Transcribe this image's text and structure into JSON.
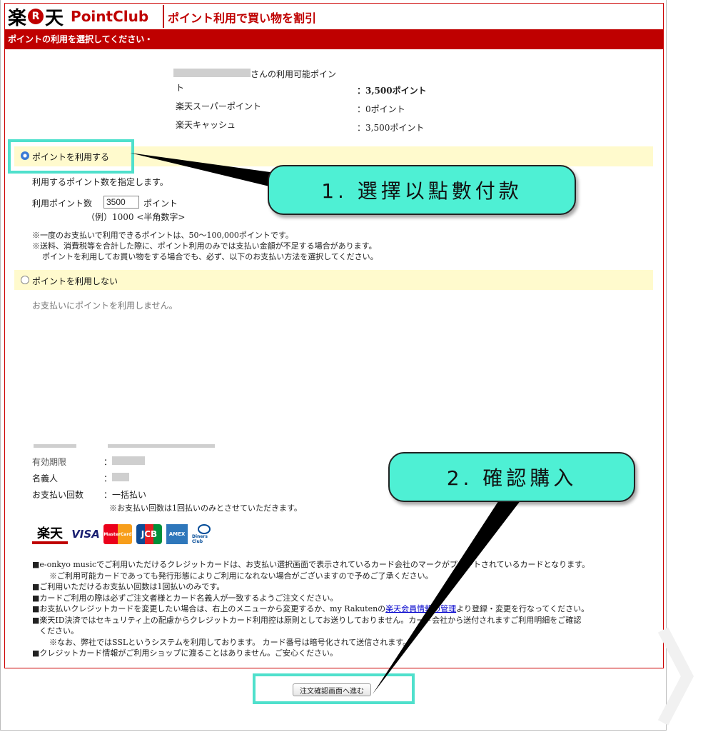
{
  "header": {
    "logo_kanji_1": "楽",
    "logo_circle": "R",
    "logo_kanji_2": "天",
    "logo_brand": "PointClub",
    "title": "ポイント利用で買い物を割引"
  },
  "section_bar": "ポイントの利用を選択してください・",
  "points": {
    "available_suffix": "さんの利用可能ポイン",
    "available_suffix_wrap": "ト",
    "available_value": "：3,500ポイント",
    "super_label": "楽天スーパーポイント",
    "super_value": "：0ポイント",
    "cash_label": "楽天キャッシュ",
    "cash_value": "：3,500ポイント"
  },
  "use_option": {
    "label": "ポイントを利用する",
    "instruction": "利用するポイント数を指定します。",
    "count_label": "利用ポイント数",
    "count_value": "3500",
    "count_unit": "ポイント",
    "example": "（例）1000 <半角数字>",
    "note1": "※一度のお支払いで利用できるポイントは、50～100,000ポイントです。",
    "note2": "※送料、消費税等を合計した際に、ポイント利用のみでは支払い金額が不足する場合があります。",
    "note3": "ポイントを利用してお買い物をする場合でも、必ず、以下のお支払い方法を選択してください。"
  },
  "nouse_option": {
    "label": "ポイントを利用しない",
    "desc": "お支払いにポイントを利用しません。"
  },
  "card": {
    "expiry_label": "有効期限",
    "name_label": "名義人",
    "installment_label": "お支払い回数",
    "installment_value": "：一括払い",
    "installment_note": "※お支払い回数は1回払いのみとさせていただきます。",
    "logos": [
      "楽天",
      "VISA",
      "MasterCard",
      "JCB",
      "AMEX",
      "Diners Club"
    ]
  },
  "notices": {
    "n1": "■e-onkyo musicでご利用いただけるクレジットカードは、お支払い選択画面で表示されているカード会社のマークがプリントされているカードとなります。",
    "n1b": "※ご利用可能カードであっても発行形態によりご利用になれない場合がございますので予めご了承ください。",
    "n2": "■ご利用いただけるお支払い回数は1回払いのみです。",
    "n3": "■カードご利用の際は必ずご注文者様とカード名義人が一致するようご注文ください。",
    "n4_pre": "■お支払いクレジットカードを変更したい場合は、右上のメニューから変更するか、my Rakutenの",
    "n4_link": "楽天会員情報の管理",
    "n4_post": "より登録・変更を行なってください。",
    "n5": "■楽天ID決済ではセキュリティ上の配慮からクレジットカード利用控は原則としてお送りしておりません。カード会社から送付されますご利用明細をご確認",
    "n5b": "ください。",
    "n5c": "※なお、弊社ではSSLというシステムを利用しております。 カード番号は暗号化されて送信されます。",
    "n6": "■クレジットカード情報がご利用ショップに渡ることはありません。ご安心ください。"
  },
  "submit_button": "注文確認画面へ進む",
  "callouts": {
    "step1": "1. 選擇以點數付款",
    "step2": "2. 確認購入"
  },
  "colors": {
    "brand_red": "#bf0000",
    "highlight": "#4fe0cc",
    "callout_fill": "#4ef0d4",
    "option_bg": "#fffacd"
  }
}
